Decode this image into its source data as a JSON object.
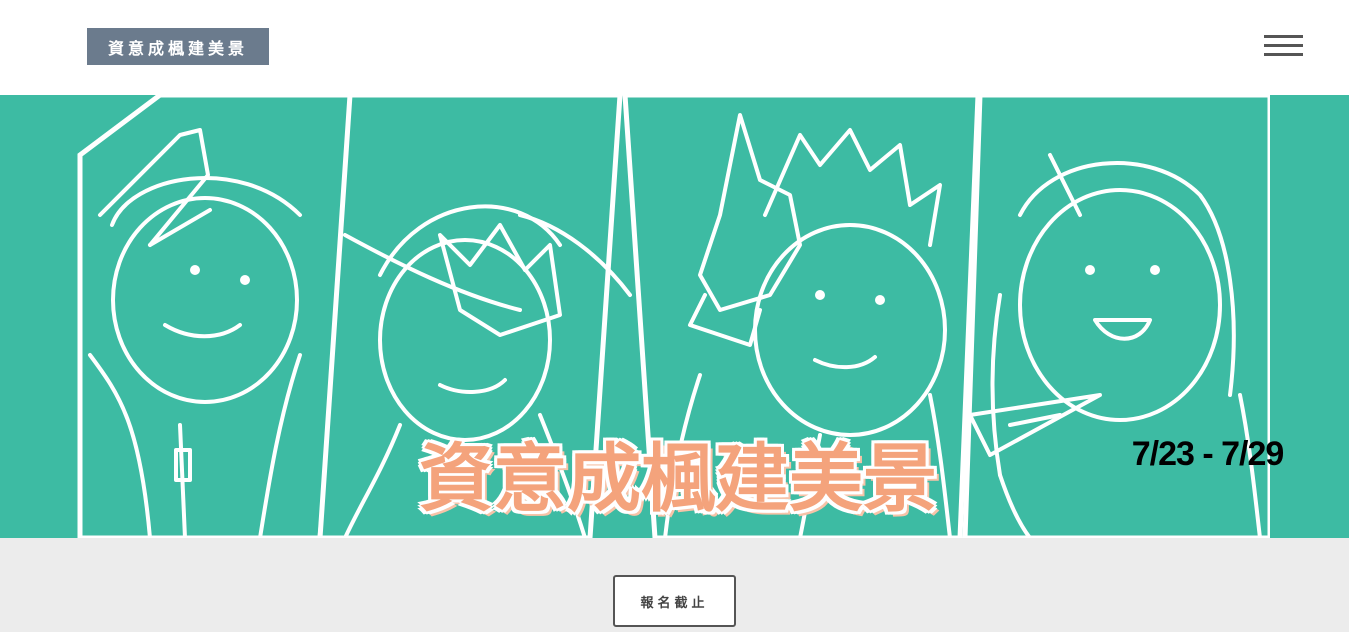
{
  "header": {
    "brand": "資意成楓建美景",
    "menu_icon": "hamburger-menu-icon"
  },
  "hero": {
    "title": "資意成楓建美景",
    "date_range": "7/23 - 7/29",
    "colors": {
      "background": "#3dbba3",
      "title": "#f4a37c",
      "date": "#000000",
      "lines": "#ffffff"
    }
  },
  "registration": {
    "status_label": "報名截止"
  }
}
